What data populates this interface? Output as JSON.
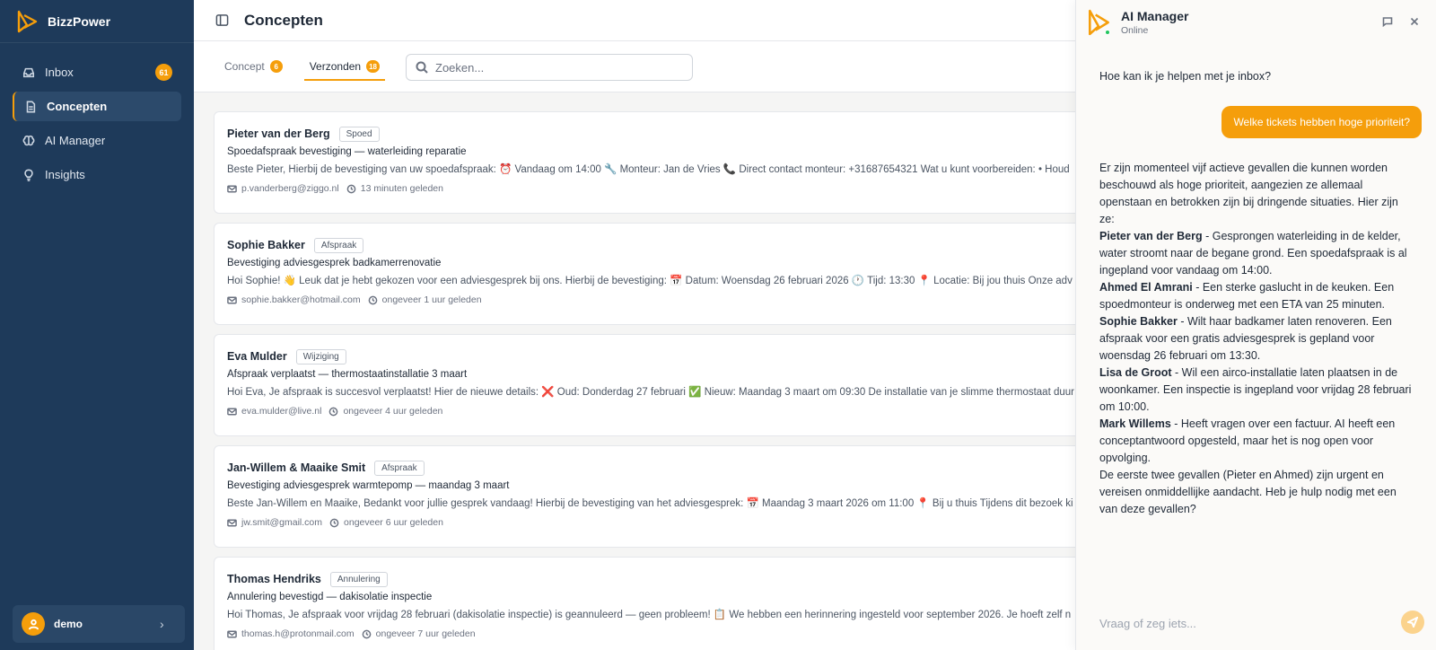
{
  "brand": {
    "name": "BizzPower",
    "accent": "#f59e0b",
    "sidebar_bg": "#1e3a5a"
  },
  "sidebar": {
    "items": [
      {
        "label": "Inbox",
        "icon": "inbox-icon",
        "badge": "61"
      },
      {
        "label": "Concepten",
        "icon": "document-icon",
        "active": true
      },
      {
        "label": "AI Manager",
        "icon": "brain-icon"
      },
      {
        "label": "Insights",
        "icon": "lightbulb-icon"
      }
    ],
    "user": {
      "name": "demo"
    }
  },
  "header": {
    "title": "Concepten"
  },
  "tabs": [
    {
      "label": "Concept",
      "count": "6"
    },
    {
      "label": "Verzonden",
      "count": "18",
      "active": true
    }
  ],
  "search": {
    "placeholder": "Zoeken..."
  },
  "emails": [
    {
      "sender": "Pieter van der Berg",
      "tag": "Spoed",
      "subject": "Spoedafspraak bevestiging — waterleiding reparatie",
      "preview": "Beste Pieter, Hierbij de bevestiging van uw spoedafspraak: ⏰ Vandaag om 14:00 🔧 Monteur: Jan de Vries 📞 Direct contact monteur: +31687654321 Wat u kunt voorbereiden: • Houd",
      "email": "p.vanderberg@ziggo.nl",
      "time": "13 minuten geleden"
    },
    {
      "sender": "Sophie Bakker",
      "tag": "Afspraak",
      "subject": "Bevestiging adviesgesprek badkamerrenovatie",
      "preview": "Hoi Sophie! 👋 Leuk dat je hebt gekozen voor een adviesgesprek bij ons. Hierbij de bevestiging: 📅 Datum: Woensdag 26 februari 2026 🕐 Tijd: 13:30 📍 Locatie: Bij jou thuis Onze adv",
      "email": "sophie.bakker@hotmail.com",
      "time": "ongeveer 1 uur geleden"
    },
    {
      "sender": "Eva Mulder",
      "tag": "Wijziging",
      "subject": "Afspraak verplaatst — thermostaatinstallatie 3 maart",
      "preview": "Hoi Eva, Je afspraak is succesvol verplaatst! Hier de nieuwe details: ❌ Oud: Donderdag 27 februari ✅ Nieuw: Maandag 3 maart om 09:30 De installatie van je slimme thermostaat duur",
      "email": "eva.mulder@live.nl",
      "time": "ongeveer 4 uur geleden"
    },
    {
      "sender": "Jan-Willem & Maaike Smit",
      "tag": "Afspraak",
      "subject": "Bevestiging adviesgesprek warmtepomp — maandag 3 maart",
      "preview": "Beste Jan-Willem en Maaike, Bedankt voor jullie gesprek vandaag! Hierbij de bevestiging van het adviesgesprek: 📅 Maandag 3 maart 2026 om 11:00 📍 Bij u thuis Tijdens dit bezoek ki",
      "email": "jw.smit@gmail.com",
      "time": "ongeveer 6 uur geleden"
    },
    {
      "sender": "Thomas Hendriks",
      "tag": "Annulering",
      "subject": "Annulering bevestigd — dakisolatie inspectie",
      "preview": "Hoi Thomas, Je afspraak voor vrijdag 28 februari (dakisolatie inspectie) is geannuleerd — geen probleem! 📋 We hebben een herinnering ingesteld voor september 2026. Je hoeft zelf n",
      "email": "thomas.h@protonmail.com",
      "time": "ongeveer 7 uur geleden"
    }
  ],
  "ai": {
    "title": "AI Manager",
    "status": "Online",
    "first_message": "Hoe kan ik je helpen met je inbox?",
    "user_message": "Welke tickets hebben hoge prioriteit?",
    "intro": "Er zijn momenteel vijf actieve gevallen die kunnen worden beschouwd als hoge prioriteit, aangezien ze allemaal openstaan en betrokken zijn bij dringende situaties. Hier zijn ze:",
    "cases": [
      {
        "name": "Pieter van der Berg",
        "text": " - Gesprongen waterleiding in de kelder, water stroomt naar de begane grond. Een spoedafspraak is al ingepland voor vandaag om 14:00."
      },
      {
        "name": "Ahmed El Amrani",
        "text": " - Een sterke gaslucht in de keuken. Een spoedmonteur is onderweg met een ETA van 25 minuten."
      },
      {
        "name": "Sophie Bakker",
        "text": " - Wilt haar badkamer laten renoveren. Een afspraak voor een gratis adviesgesprek is gepland voor woensdag 26 februari om 13:30."
      },
      {
        "name": "Lisa de Groot",
        "text": " - Wil een airco-installatie laten plaatsen in de woonkamer. Een inspectie is ingepland voor vrijdag 28 februari om 10:00."
      },
      {
        "name": "Mark Willems",
        "text": " - Heeft vragen over een factuur. AI heeft een conceptantwoord opgesteld, maar het is nog open voor opvolging."
      }
    ],
    "outro": "De eerste twee gevallen (Pieter en Ahmed) zijn urgent en vereisen onmiddellijke aandacht. Heb je hulp nodig met een van deze gevallen?",
    "input_placeholder": "Vraag of zeg iets..."
  }
}
